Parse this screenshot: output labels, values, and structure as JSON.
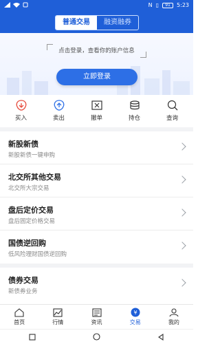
{
  "status_bar": {
    "time": "5:23",
    "battery": "91",
    "nfc": "N"
  },
  "segment": {
    "tabs": [
      {
        "label": "普通交易",
        "active": true
      },
      {
        "label": "融资融券",
        "active": false
      }
    ]
  },
  "hero": {
    "hint": "点击登录，查看你的账户信息",
    "login_button": "立即登录"
  },
  "quick_actions": [
    {
      "label": "买入",
      "icon": "buy-icon"
    },
    {
      "label": "卖出",
      "icon": "sell-icon"
    },
    {
      "label": "撤单",
      "icon": "cancel-order-icon"
    },
    {
      "label": "持仓",
      "icon": "holdings-icon"
    },
    {
      "label": "查询",
      "icon": "search-icon"
    }
  ],
  "menu_group1": [
    {
      "title": "新股新债",
      "subtitle": "新股新债一键申购"
    },
    {
      "title": "北交所其他交易",
      "subtitle": "北交所大宗交易"
    },
    {
      "title": "盘后定价交易",
      "subtitle": "盘后固定价格交易"
    },
    {
      "title": "国债逆回购",
      "subtitle": "低风险理财国债逆回购"
    }
  ],
  "menu_group2": [
    {
      "title": "债券交易",
      "subtitle": "新债券业务"
    }
  ],
  "tabbar": [
    {
      "label": "首页",
      "icon": "home-icon",
      "active": false
    },
    {
      "label": "行情",
      "icon": "market-icon",
      "active": false
    },
    {
      "label": "资讯",
      "icon": "news-icon",
      "active": false
    },
    {
      "label": "交易",
      "icon": "trade-icon",
      "active": true
    },
    {
      "label": "我的",
      "icon": "profile-icon",
      "active": false
    }
  ],
  "colors": {
    "primary": "#1f5fd8",
    "accent_red": "#e64a3b",
    "accent_blue": "#2d6fe6"
  }
}
